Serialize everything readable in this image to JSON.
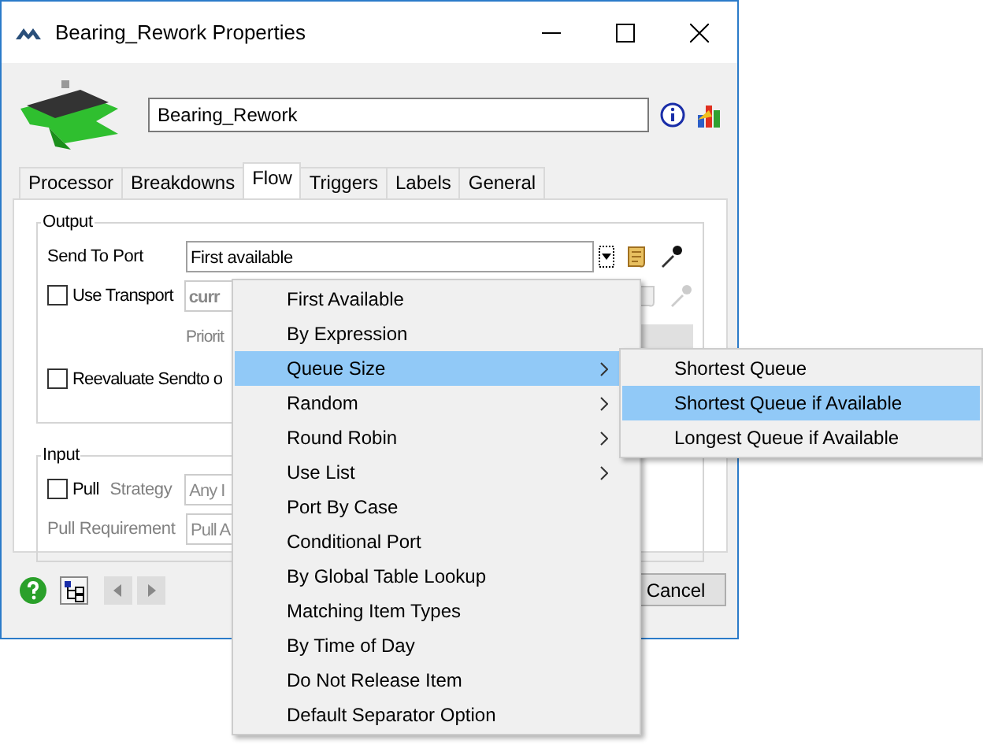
{
  "window": {
    "title": "Bearing_Rework  Properties"
  },
  "object_name": {
    "value": "Bearing_Rework"
  },
  "tabs": [
    {
      "label": "Processor",
      "selected": false
    },
    {
      "label": "Breakdowns",
      "selected": false
    },
    {
      "label": "Flow",
      "selected": true
    },
    {
      "label": "Triggers",
      "selected": false
    },
    {
      "label": "Labels",
      "selected": false
    },
    {
      "label": "General",
      "selected": false
    }
  ],
  "output": {
    "label": "Output",
    "send_to_port": {
      "label": "Send To Port",
      "value": "First available"
    },
    "use_transport": {
      "label": "Use Transport",
      "checked": false,
      "value": "curr"
    },
    "priority_label": "Priorit",
    "reevaluate": {
      "label": "Reevaluate Sendto o",
      "checked": false
    }
  },
  "input": {
    "label": "Input",
    "pull": {
      "label": "Pull",
      "checked": false
    },
    "strategy": {
      "label": "Strategy",
      "value": "Any I"
    },
    "pull_requirement": {
      "label": "Pull Requirement",
      "value": "Pull A"
    }
  },
  "buttons": [
    "Cancel"
  ],
  "menu": {
    "items": [
      {
        "label": "First Available",
        "submenu": false,
        "selected": false
      },
      {
        "label": "By Expression",
        "submenu": false,
        "selected": false
      },
      {
        "label": "Queue Size",
        "submenu": true,
        "selected": true
      },
      {
        "label": "Random",
        "submenu": true,
        "selected": false
      },
      {
        "label": "Round Robin",
        "submenu": true,
        "selected": false
      },
      {
        "label": "Use List",
        "submenu": true,
        "selected": false
      },
      {
        "label": "Port By Case",
        "submenu": false,
        "selected": false
      },
      {
        "label": "Conditional Port",
        "submenu": false,
        "selected": false
      },
      {
        "label": "By Global Table Lookup",
        "submenu": false,
        "selected": false
      },
      {
        "label": "Matching Item Types",
        "submenu": false,
        "selected": false
      },
      {
        "label": "By Time of Day",
        "submenu": false,
        "selected": false
      },
      {
        "label": "Do Not Release Item",
        "submenu": false,
        "selected": false
      },
      {
        "label": "Default Separator Option",
        "submenu": false,
        "selected": false
      }
    ]
  },
  "submenu": {
    "items": [
      {
        "label": "Shortest Queue",
        "selected": false
      },
      {
        "label": "Shortest Queue if Available",
        "selected": true
      },
      {
        "label": "Longest Queue if Available",
        "selected": false
      }
    ]
  }
}
